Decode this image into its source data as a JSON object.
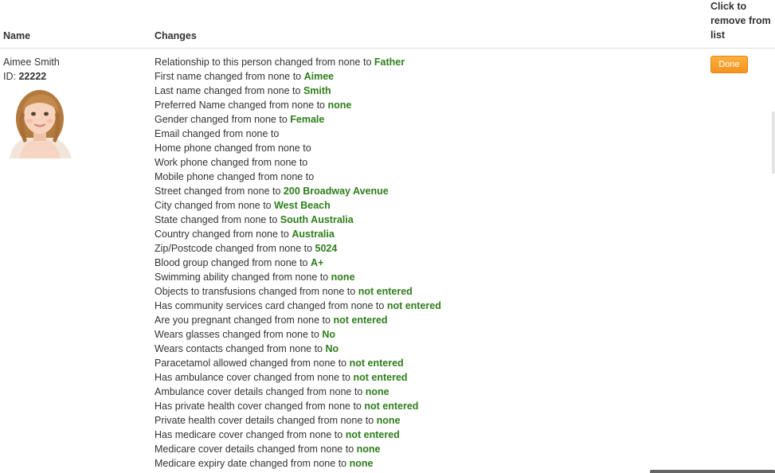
{
  "columns": {
    "name": "Name",
    "changes": "Changes",
    "remove": "Click to remove from list"
  },
  "person": {
    "name": "Aimee Smith",
    "id_label": "ID:",
    "id_value": "22222"
  },
  "done_label": "Done",
  "changes": [
    {
      "text": "Relationship to this person changed from none to",
      "value": "Father"
    },
    {
      "text": "First name changed from none to",
      "value": "Aimee"
    },
    {
      "text": "Last name changed from none to",
      "value": "Smith"
    },
    {
      "text": "Preferred Name changed from none to",
      "value": "none"
    },
    {
      "text": "Gender changed from none to",
      "value": "Female"
    },
    {
      "text": "Email changed from none to",
      "value": ""
    },
    {
      "text": "Home phone changed from none to",
      "value": ""
    },
    {
      "text": "Work phone changed from none to",
      "value": ""
    },
    {
      "text": "Mobile phone changed from none to",
      "value": ""
    },
    {
      "text": "Street changed from none to",
      "value": "200 Broadway Avenue"
    },
    {
      "text": "City changed from none to",
      "value": "West Beach"
    },
    {
      "text": "State changed from none to",
      "value": "South Australia"
    },
    {
      "text": "Country changed from none to",
      "value": "Australia"
    },
    {
      "text": "Zip/Postcode changed from none to",
      "value": "5024"
    },
    {
      "text": "Blood group changed from none to",
      "value": "A+"
    },
    {
      "text": "Swimming ability changed from none to",
      "value": "none"
    },
    {
      "text": "Objects to transfusions changed from none to",
      "value": "not entered"
    },
    {
      "text": "Has community services card changed from none to",
      "value": "not entered"
    },
    {
      "text": "Are you pregnant changed from none to",
      "value": "not entered"
    },
    {
      "text": "Wears glasses changed from none to",
      "value": "No"
    },
    {
      "text": "Wears contacts changed from none to",
      "value": "No"
    },
    {
      "text": "Paracetamol allowed changed from none to",
      "value": "not entered"
    },
    {
      "text": "Has ambulance cover changed from none to",
      "value": "not entered"
    },
    {
      "text": "Ambulance cover details changed from none to",
      "value": "none"
    },
    {
      "text": "Has private health cover changed from none to",
      "value": "not entered"
    },
    {
      "text": "Private health cover details changed from none to",
      "value": "none"
    },
    {
      "text": "Has medicare cover changed from none to",
      "value": "not entered"
    },
    {
      "text": "Medicare cover details changed from none to",
      "value": "none"
    },
    {
      "text": "Medicare expiry date changed from none to",
      "value": "none"
    }
  ],
  "colors": {
    "value_green": "#2e7d1a",
    "done_orange": "#f5921e"
  }
}
